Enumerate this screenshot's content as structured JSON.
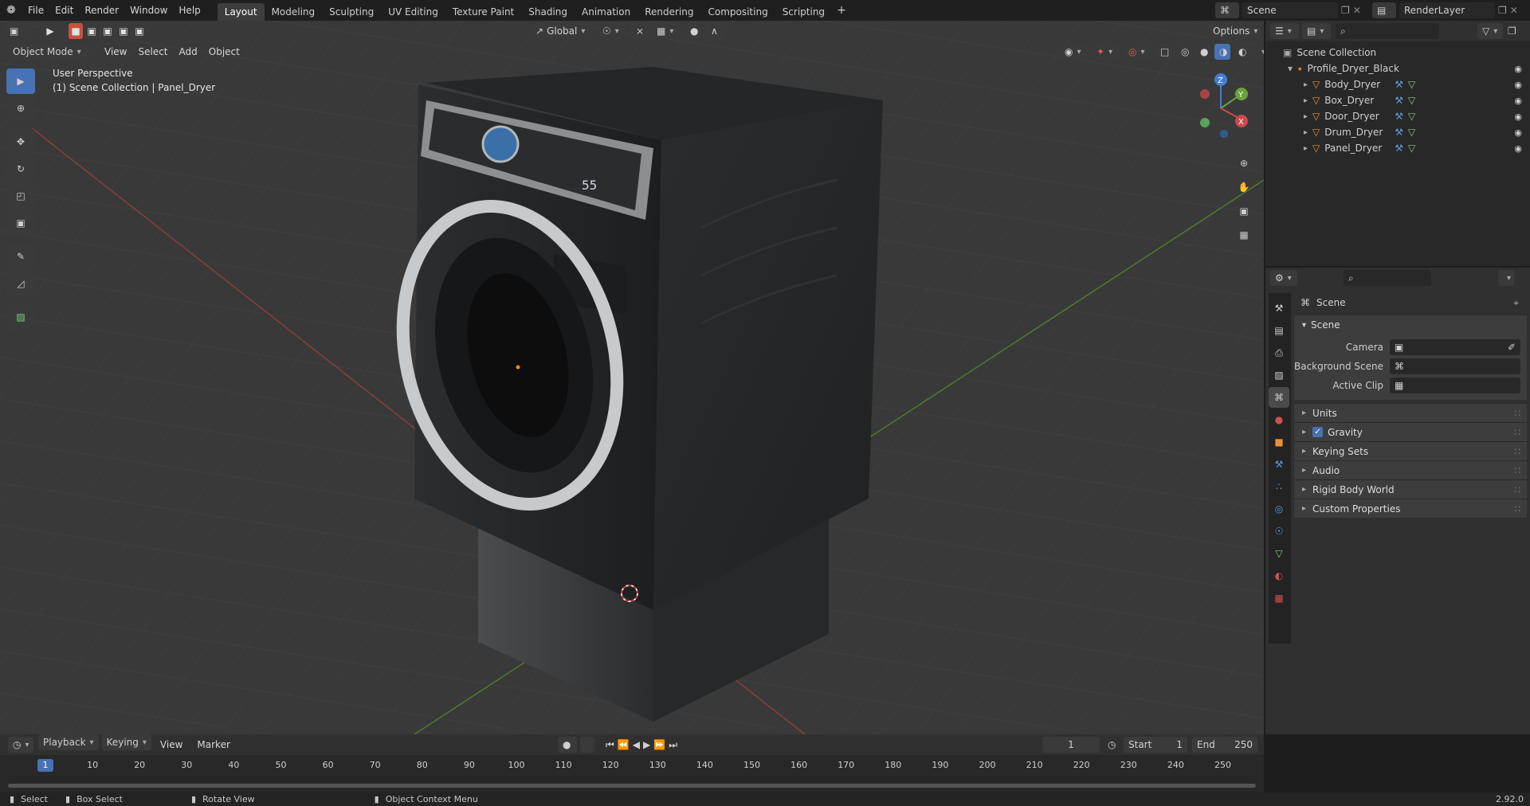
{
  "topbar": {
    "menus": [
      "File",
      "Edit",
      "Render",
      "Window",
      "Help"
    ],
    "workspaces": [
      "Layout",
      "Modeling",
      "Sculpting",
      "UV Editing",
      "Texture Paint",
      "Shading",
      "Animation",
      "Rendering",
      "Compositing",
      "Scripting"
    ],
    "add_tab": "+",
    "scene": "Scene",
    "view_layer": "RenderLayer"
  },
  "viewport": {
    "mode": "Object Mode",
    "menus": [
      "View",
      "Select",
      "Add",
      "Object"
    ],
    "transform_orientation": "Global",
    "options": "Options",
    "overlay_title": "User Perspective",
    "overlay_sub": "(1) Scene Collection | Panel_Dryer",
    "gizmo": {
      "x": "X",
      "y": "Y",
      "z": "Z"
    },
    "dryer_display": "55"
  },
  "outliner": {
    "root": "Scene Collection",
    "collection": "Profile_Dryer_Black",
    "objects": [
      "Body_Dryer",
      "Box_Dryer",
      "Door_Dryer",
      "Drum_Dryer",
      "Panel_Dryer"
    ]
  },
  "properties": {
    "context": "Scene",
    "panel_title": "Scene",
    "camera_label": "Camera",
    "background_label": "Background Scene",
    "clip_label": "Active Clip",
    "subpanels": [
      "Units",
      "Gravity",
      "Keying Sets",
      "Audio",
      "Rigid Body World",
      "Custom Properties"
    ],
    "gravity_checked": true
  },
  "timeline": {
    "menus": [
      "Playback",
      "Keying",
      "View",
      "Marker"
    ],
    "current_frame": "1",
    "start_label": "Start",
    "start": "1",
    "end_label": "End",
    "end": "250",
    "ticks": [
      "10",
      "20",
      "30",
      "40",
      "50",
      "60",
      "70",
      "80",
      "90",
      "100",
      "110",
      "120",
      "130",
      "140",
      "150",
      "160",
      "170",
      "180",
      "190",
      "200",
      "210",
      "220",
      "230",
      "240",
      "250"
    ],
    "playhead": "1"
  },
  "status": {
    "select": "Select",
    "box_select": "Box Select",
    "rotate": "Rotate View",
    "context": "Object Context Menu",
    "version": "2.92.0"
  },
  "colors": {
    "accent": "#4772b3",
    "x_axis": "#c84b4b",
    "y_axis": "#6ba33b",
    "z_axis": "#3f7fd6",
    "object_icon": "#e8903c"
  }
}
